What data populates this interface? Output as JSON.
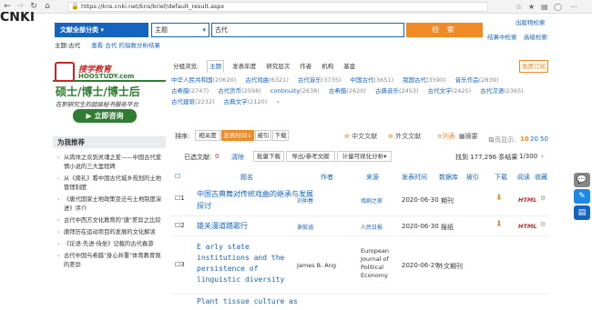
{
  "browser": {
    "url": "https://kns.cnki.net/kns/brief/default_result.aspx",
    "back": "←",
    "forward": "→",
    "reload": "↻",
    "home": "⌂"
  },
  "header": {
    "logo": "CNKI",
    "logo_sub": "中国知网",
    "links": [
      "出版物检索"
    ],
    "links2": [
      "结果中检索",
      "高级检索"
    ]
  },
  "search": {
    "scope": "文献全部分类",
    "field": "主题",
    "keyword": "古代",
    "button": "检 索"
  },
  "crumbs": {
    "tag": "主题:古代",
    "tag2": "查看 古代 的指数分析结果"
  },
  "ad": {
    "brand": "硕士/博士/博士后",
    "sub": "在职研究生的超级秘书服务平台",
    "cta": "立即咨询",
    "site": "HOOSTUDY.com",
    "tag": "搜学教育"
  },
  "leftnav": {
    "title": "为我推荐",
    "items": [
      "从肉体之欢到灵魂之爱——中国古代爱情小说的三大里程碑",
      "从《周礼》看中国古代城乡规划的土地管理制度",
      "《唐代国家土地政策变迁与土地制度演进》评介",
      "古代中西方文化教育的\"唐\"差异之比较",
      "唐拜历在运动项目的发展的文化解读",
      "《论语·先进·侍坐》记载的古代春游",
      "古代中国与希腊\"身心并重\"体育教育观的差异"
    ]
  },
  "groups": {
    "label": "分组浏览:",
    "tabs": [
      "主题",
      "发表年度",
      "研究层次",
      "作者",
      "机构",
      "基金"
    ],
    "subscribe": "免费订阅",
    "facets": [
      {
        "name": "中华人民共和国",
        "count": "(20620)"
      },
      {
        "name": "古代戏曲",
        "count": "(6321)"
      },
      {
        "name": "古代音乐",
        "count": "(3735)"
      },
      {
        "name": "中国古代",
        "count": "(3651)"
      },
      {
        "name": "我国古代",
        "count": "(3590)"
      },
      {
        "name": "音乐作品",
        "count": "(2839)"
      },
      {
        "name": "古希腊",
        "count": "(2747)"
      },
      {
        "name": "古代货币",
        "count": "(2598)"
      },
      {
        "name": "continuity",
        "count": "(2638)"
      },
      {
        "name": "古希腊",
        "count": "(2620)"
      },
      {
        "name": "古典音乐",
        "count": "(2453)"
      },
      {
        "name": "古代文学",
        "count": "(2425)"
      },
      {
        "name": "古代汉语",
        "count": "(2365)"
      },
      {
        "name": "古代建筑",
        "count": "(2232)"
      },
      {
        "name": "古典文学",
        "count": "(2120)"
      }
    ]
  },
  "sortbar": {
    "label": "排序:",
    "opts": [
      "相关度",
      "发表时间",
      "被引",
      "下载"
    ],
    "cn": "中文文献",
    "en": "外文文献",
    "list": "列表",
    "abs": "摘要",
    "pp_label": "每页显示:",
    "pp": [
      "10",
      "20",
      "50"
    ]
  },
  "toolbar": {
    "sel": "已选文献:",
    "sel_n": "0",
    "clear": "清除",
    "batch": "批量下载",
    "export": "导出/参考文献",
    "viz": "计量可视化分析",
    "found": "找到 177,296 条结果",
    "page": "1/300"
  },
  "table": {
    "headers": [
      "题名",
      "作者",
      "来源",
      "发表时间",
      "数据库",
      "被引",
      "下载",
      "阅读",
      "收藏"
    ],
    "rows": [
      {
        "idx": "1",
        "title": "中国古典舞对传统戏曲的继承与发展探讨",
        "author": "刘仲春",
        "source": "戏剧之家",
        "date": "2020-06-30",
        "db": "期刊",
        "read": "HTML"
      },
      {
        "idx": "2",
        "title": "雄关漫道踏歌行",
        "author": "谢俊涵",
        "source": "人民日报",
        "date": "2020-06-30",
        "db": "报纸",
        "read": "HTML"
      },
      {
        "idx": "3",
        "title": "E arly state institutions and the persistence of linguistic diversity",
        "author": "James B. Ang",
        "source": "European Journal of Political Economy",
        "date": "2020-06-29",
        "db": "外文期刊",
        "read": ""
      },
      {
        "idx": "4",
        "title": "Plant tissue culture as",
        "author": "",
        "source": "",
        "date": "",
        "db": "",
        "read": ""
      }
    ]
  }
}
